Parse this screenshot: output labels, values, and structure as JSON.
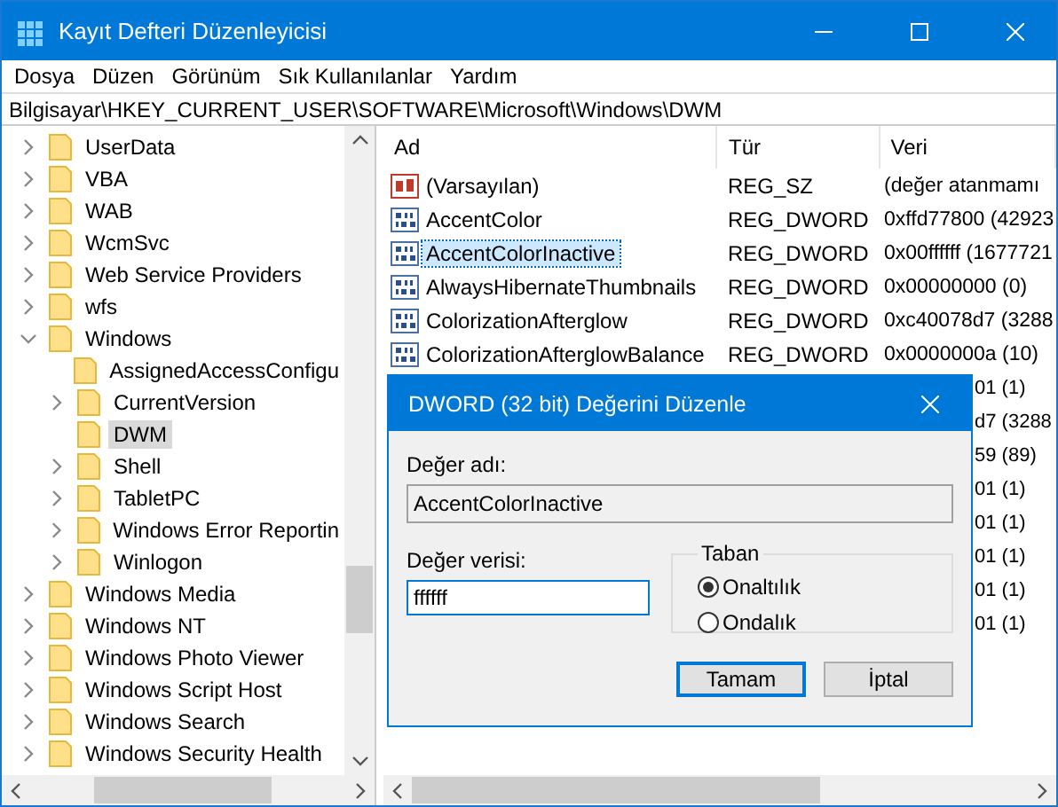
{
  "window": {
    "title": "Kayıt Defteri Düzenleyicisi"
  },
  "menu": [
    "Dosya",
    "Düzen",
    "Görünüm",
    "Sık Kullanılanlar",
    "Yardım"
  ],
  "address": "Bilgisayar\\HKEY_CURRENT_USER\\SOFTWARE\\Microsoft\\Windows\\DWM",
  "tree": [
    {
      "label": "UserData",
      "kind": "branch",
      "expanded": false,
      "selected": false
    },
    {
      "label": "VBA",
      "kind": "branch",
      "expanded": false,
      "selected": false
    },
    {
      "label": "WAB",
      "kind": "branch",
      "expanded": false,
      "selected": false
    },
    {
      "label": "WcmSvc",
      "kind": "branch",
      "expanded": false,
      "selected": false
    },
    {
      "label": "Web Service Providers",
      "kind": "branch",
      "expanded": false,
      "selected": false
    },
    {
      "label": "wfs",
      "kind": "branch",
      "expanded": false,
      "selected": false
    },
    {
      "label": "Windows",
      "kind": "branch",
      "expanded": true,
      "selected": false,
      "children": [
        {
          "label": "AssignedAccessConfigu",
          "kind": "leaf",
          "selected": false
        },
        {
          "label": "CurrentVersion",
          "kind": "branch",
          "expanded": false,
          "selected": false
        },
        {
          "label": "DWM",
          "kind": "leaf",
          "selected": true
        },
        {
          "label": "Shell",
          "kind": "branch",
          "expanded": false,
          "selected": false
        },
        {
          "label": "TabletPC",
          "kind": "branch",
          "expanded": false,
          "selected": false
        },
        {
          "label": "Windows Error Reportin",
          "kind": "branch",
          "expanded": false,
          "selected": false
        },
        {
          "label": "Winlogon",
          "kind": "branch",
          "expanded": false,
          "selected": false
        }
      ]
    },
    {
      "label": "Windows Media",
      "kind": "branch",
      "expanded": false,
      "selected": false
    },
    {
      "label": "Windows NT",
      "kind": "branch",
      "expanded": false,
      "selected": false
    },
    {
      "label": "Windows Photo Viewer",
      "kind": "branch",
      "expanded": false,
      "selected": false
    },
    {
      "label": "Windows Script Host",
      "kind": "branch",
      "expanded": false,
      "selected": false
    },
    {
      "label": "Windows Search",
      "kind": "branch",
      "expanded": false,
      "selected": false
    },
    {
      "label": "Windows Security Health",
      "kind": "branch",
      "expanded": false,
      "selected": false
    }
  ],
  "table": {
    "columns": [
      "Ad",
      "Tür",
      "Veri"
    ],
    "rows": [
      {
        "kind": "string",
        "name": "(Varsayılan)",
        "type": "REG_SZ",
        "data": "(değer atanmamı",
        "selected": false
      },
      {
        "kind": "dword",
        "name": "AccentColor",
        "type": "REG_DWORD",
        "data": "0xffd77800 (42923",
        "selected": false
      },
      {
        "kind": "dword",
        "name": "AccentColorInactive",
        "type": "REG_DWORD",
        "data": "0x00ffffff (1677721",
        "selected": true
      },
      {
        "kind": "dword",
        "name": "AlwaysHibernateThumbnails",
        "type": "REG_DWORD",
        "data": "0x00000000 (0)",
        "selected": false
      },
      {
        "kind": "dword",
        "name": "ColorizationAfterglow",
        "type": "REG_DWORD",
        "data": "0xc40078d7 (3288",
        "selected": false
      },
      {
        "kind": "dword",
        "name": "ColorizationAfterglowBalance",
        "type": "REG_DWORD",
        "data": "0x0000000a (10)",
        "selected": false
      },
      {
        "kind": "hidden",
        "data": "01 (1)"
      },
      {
        "kind": "hidden",
        "data": "d7 (3288"
      },
      {
        "kind": "hidden",
        "data": "59 (89)"
      },
      {
        "kind": "hidden",
        "data": "01 (1)"
      },
      {
        "kind": "hidden",
        "data": "01 (1)"
      },
      {
        "kind": "hidden",
        "data": "01 (1)"
      },
      {
        "kind": "hidden",
        "data": "01 (1)"
      },
      {
        "kind": "hidden",
        "data": "01 (1)"
      }
    ]
  },
  "dialog": {
    "title": "DWORD (32 bit) Değerini Düzenle",
    "name_label": "Değer adı:",
    "name_value": "AccentColorInactive",
    "data_label": "Değer verisi:",
    "data_value": "ffffff",
    "base_group": "Taban",
    "base_options": [
      {
        "label": "Onaltılık",
        "selected": true
      },
      {
        "label": "Ondalık",
        "selected": false
      }
    ],
    "buttons": [
      "Tamam",
      "İptal"
    ]
  }
}
